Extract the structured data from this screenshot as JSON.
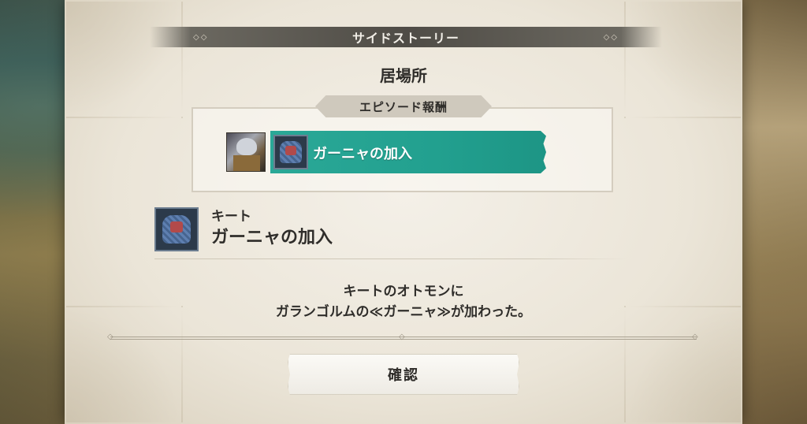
{
  "dialog": {
    "title": "サイドストーリー",
    "location": "居場所",
    "reward_header": "エピソード報酬",
    "reward_item": {
      "label": "ガーニャの加入",
      "icon": "monster-icon"
    },
    "portrait_icon": "character-portrait",
    "detail": {
      "subtitle": "キート",
      "title": "ガーニャの加入",
      "icon": "monster-icon"
    },
    "description_line1": "キートのオトモンに",
    "description_line2": "ガランゴルムの≪ガーニャ≫が加わった。",
    "confirm_label": "確認"
  },
  "colors": {
    "reward_teal": "#22a08f",
    "title_banner": "#4f4c46",
    "parchment": "#ebe5d8"
  }
}
